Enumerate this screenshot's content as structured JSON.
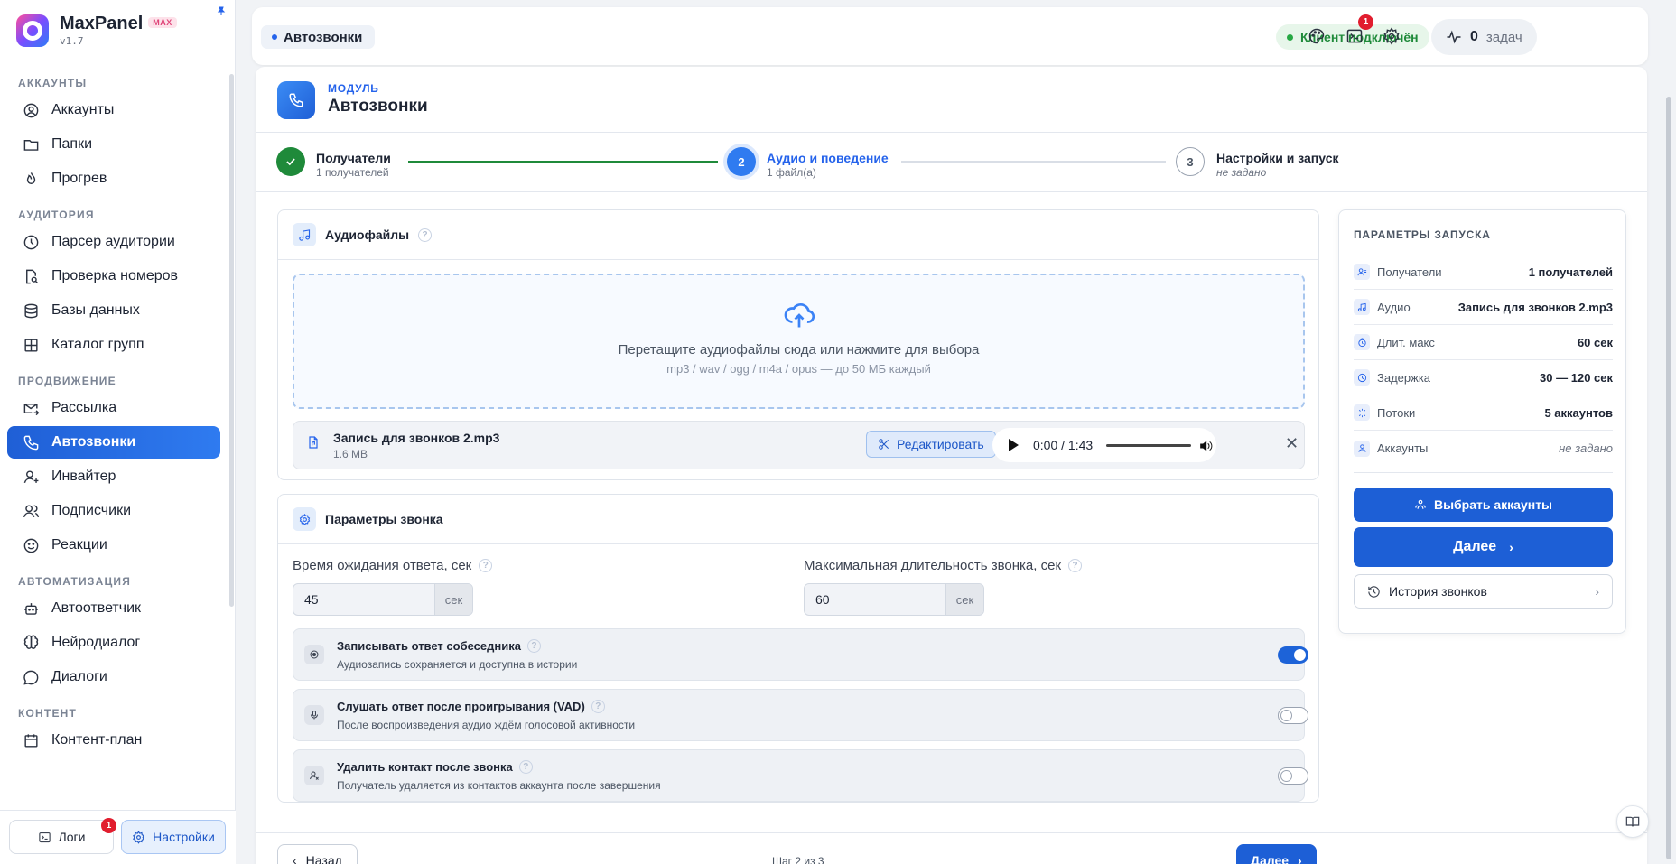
{
  "brand": {
    "name": "MaxPanel",
    "badge": "MAX",
    "version": "v1.7"
  },
  "sidebar": {
    "sections": [
      {
        "title": "АККАУНТЫ",
        "items": [
          {
            "label": "Аккаунты",
            "icon": "user-circle-icon"
          },
          {
            "label": "Папки",
            "icon": "folder-icon"
          },
          {
            "label": "Прогрев",
            "icon": "flame-icon"
          }
        ]
      },
      {
        "title": "АУДИТОРИЯ",
        "items": [
          {
            "label": "Парсер аудитории",
            "icon": "clock-icon"
          },
          {
            "label": "Проверка номеров",
            "icon": "file-search-icon"
          },
          {
            "label": "Базы данных",
            "icon": "database-icon"
          },
          {
            "label": "Каталог групп",
            "icon": "grid-icon"
          }
        ]
      },
      {
        "title": "ПРОДВИЖЕНИЕ",
        "items": [
          {
            "label": "Рассылка",
            "icon": "mail-send-icon"
          },
          {
            "label": "Автозвонки",
            "icon": "phone-icon",
            "active": true
          },
          {
            "label": "Инвайтер",
            "icon": "user-plus-icon"
          },
          {
            "label": "Подписчики",
            "icon": "users-icon"
          },
          {
            "label": "Реакции",
            "icon": "smile-icon"
          }
        ]
      },
      {
        "title": "АВТОМАТИЗАЦИЯ",
        "items": [
          {
            "label": "Автоответчик",
            "icon": "bot-icon"
          },
          {
            "label": "Нейродиалог",
            "icon": "brain-icon"
          },
          {
            "label": "Диалоги",
            "icon": "chat-bubble-icon"
          }
        ]
      },
      {
        "title": "КОНТЕНТ",
        "items": [
          {
            "label": "Контент-план",
            "icon": "calendar-icon"
          }
        ]
      }
    ],
    "footer": {
      "logs_label": "Логи",
      "logs_badge": "1",
      "settings_label": "Настройки"
    }
  },
  "topbar": {
    "breadcrumb": "Автозвонки",
    "connection_status": "Клиент подключён",
    "tasks_count": "0",
    "tasks_label": "задач",
    "terminal_badge": "1"
  },
  "module": {
    "kicker": "МОДУЛЬ",
    "title": "Автозвонки"
  },
  "stepper": [
    {
      "num": "1",
      "title": "Получатели",
      "sub": "1 получателей",
      "state": "done"
    },
    {
      "num": "2",
      "title": "Аудио и поведение",
      "sub": "1 файл(а)",
      "state": "active"
    },
    {
      "num": "3",
      "title": "Настройки и запуск",
      "sub": "не задано",
      "state": "pending"
    }
  ],
  "audio": {
    "title": "Аудиофайлы",
    "help": "?",
    "drop_main": "Перетащите аудиофайлы сюда или нажмите для выбора",
    "drop_sub": "mp3 / wav / ogg / m4a / opus — до 50 МБ каждый",
    "file": {
      "name": "Запись для звонков 2.mp3",
      "size": "1.6 MB",
      "edit_label": "Редактировать",
      "time": "0:00 / 1:43",
      "close": "✕"
    }
  },
  "call_params": {
    "title": "Параметры звонка",
    "wait_label": "Время ожидания ответа, сек",
    "wait_value": "45",
    "max_label": "Максимальная длительность звонка, сек",
    "max_value": "60",
    "unit": "сек",
    "options": [
      {
        "title": "Записывать ответ собеседника",
        "sub": "Аудиозапись сохраняется и доступна в истории",
        "on": true
      },
      {
        "title": "Слушать ответ после проигрывания (VAD)",
        "sub": "После воспроизведения аудио ждём голосовой активности",
        "on": false
      },
      {
        "title": "Удалить контакт после звонка",
        "sub": "Получатель удаляется из контактов аккаунта после завершения",
        "on": false
      }
    ]
  },
  "launch": {
    "title": "ПАРАМЕТРЫ ЗАПУСКА",
    "rows": [
      {
        "key": "Получатели",
        "value": "1 получателей"
      },
      {
        "key": "Аудио",
        "value": "Запись для звонков 2.mp3"
      },
      {
        "key": "Длит. макс",
        "value": "60 сек"
      },
      {
        "key": "Задержка",
        "value": "30 — 120 сек"
      },
      {
        "key": "Потоки",
        "value": "5 аккаунтов"
      },
      {
        "key": "Аккаунты",
        "value": "не задано"
      }
    ],
    "choose_accounts": "Выбрать аккаунты",
    "next": "Далее",
    "history": "История звонков"
  },
  "footer_nav": {
    "back": "Назад",
    "step_of": "Шаг 2 из 3",
    "next": "Далее"
  },
  "colors": {
    "accent": "#1d5fd6",
    "success": "#27a844",
    "danger": "#e11d2e"
  }
}
